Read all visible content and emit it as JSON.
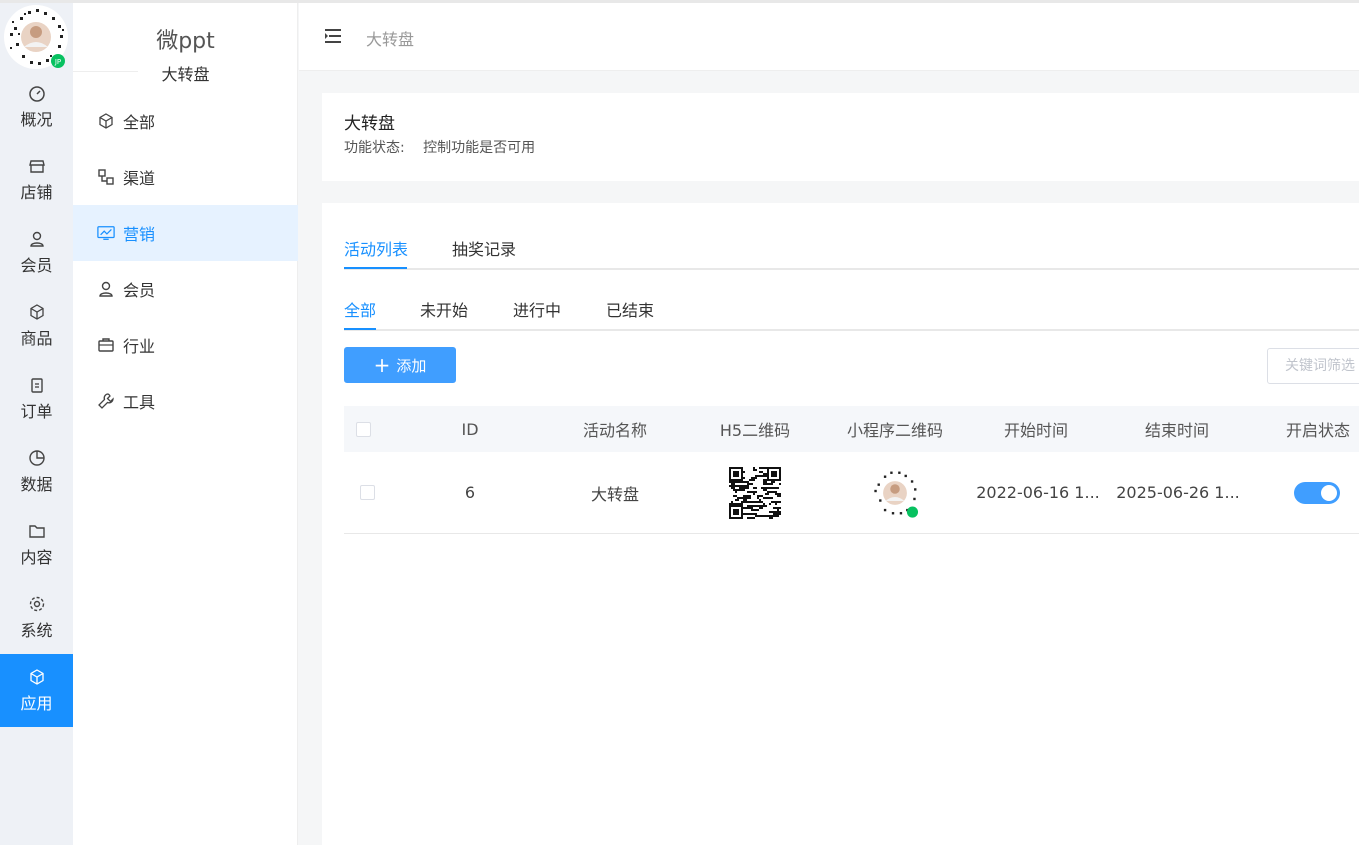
{
  "app": {
    "brand": "微ppt",
    "brand_sub": "大转盘"
  },
  "rail": [
    {
      "label": "概况",
      "icon": "dashboard-icon"
    },
    {
      "label": "店铺",
      "icon": "shop-icon"
    },
    {
      "label": "会员",
      "icon": "user-icon"
    },
    {
      "label": "商品",
      "icon": "cube-icon"
    },
    {
      "label": "订单",
      "icon": "clipboard-icon"
    },
    {
      "label": "数据",
      "icon": "pie-icon"
    },
    {
      "label": "内容",
      "icon": "folder-icon"
    },
    {
      "label": "系统",
      "icon": "gear-icon"
    },
    {
      "label": "应用",
      "icon": "cube-icon",
      "active": true
    }
  ],
  "sidebar": [
    {
      "label": "全部",
      "icon": "cube-icon"
    },
    {
      "label": "渠道",
      "icon": "channel-icon"
    },
    {
      "label": "营销",
      "icon": "chart-icon",
      "active": true
    },
    {
      "label": "会员",
      "icon": "user-icon"
    },
    {
      "label": "行业",
      "icon": "briefcase-icon"
    },
    {
      "label": "工具",
      "icon": "wrench-icon"
    }
  ],
  "header": {
    "breadcrumb": "大转盘"
  },
  "info": {
    "title": "大转盘",
    "status_key": "功能状态:",
    "status_value": "控制功能是否可用"
  },
  "tabs": [
    "活动列表",
    "抽奖记录"
  ],
  "filters": [
    "全部",
    "未开始",
    "进行中",
    "已结束"
  ],
  "toolbar": {
    "add_label": "添加",
    "keyword_placeholder": "关键词筛选"
  },
  "table": {
    "columns": [
      "ID",
      "活动名称",
      "H5二维码",
      "小程序二维码",
      "开始时间",
      "结束时间",
      "开启状态"
    ],
    "rows": [
      {
        "id": "6",
        "name": "大转盘",
        "start": "2022-06-16 1...",
        "end": "2025-06-26 1...",
        "enabled": true
      }
    ]
  },
  "colors": {
    "accent": "#1890ff",
    "button": "#409eff"
  }
}
